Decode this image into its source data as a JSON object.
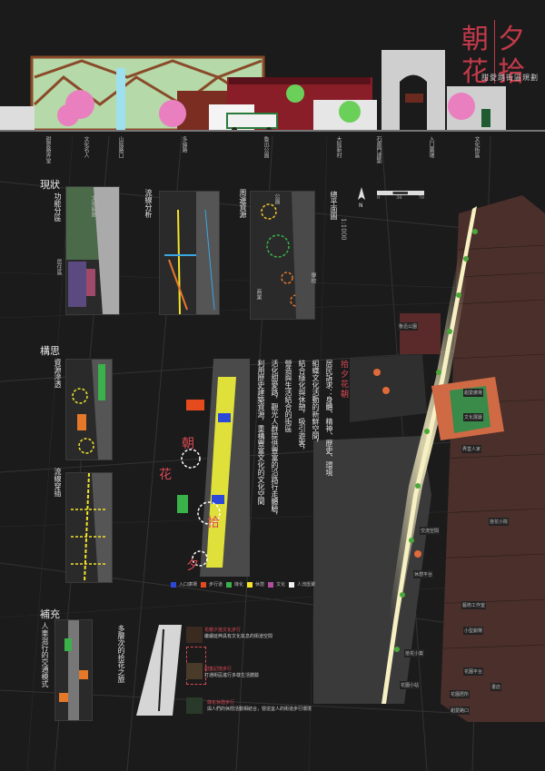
{
  "title": {
    "chars": [
      "朝",
      "夕",
      "花",
      "拾"
    ],
    "subtitle": "甜愛路街區規劃"
  },
  "elevation_labels": [
    "甜愛路弄堂",
    "文化名人",
    "山陰路口",
    "多倫路",
    "魯迅公園",
    "大陸新村",
    "石庫門建築",
    "入口廣場",
    "文化街區"
  ],
  "sections": {
    "current": {
      "heading": "現狀",
      "sub": "功能分區"
    },
    "flow": {
      "heading": "流線分析"
    },
    "surround": {
      "heading": "周邊資源"
    },
    "masterplan": {
      "heading": "總平面圖",
      "scale": "1:1000",
      "scale_ticks": [
        "0",
        "30",
        "70"
      ]
    },
    "concept": {
      "heading": "構思",
      "sub1": "資源滲透",
      "sub2": "流線穿插"
    },
    "supplement": {
      "heading": "補充",
      "sub": "人車混行的交通模式"
    },
    "multi": {
      "heading": "多層次的拾花之旅"
    }
  },
  "concept_text": {
    "heading": "拾夕花朝",
    "lines": [
      "居民訴求：身體、精神、歷史、環境",
      "組織文化活動的新鮮空間，",
      "結合綠化與休憩，吸引遊客，",
      "營造與生活結合的街區",
      "活化甜愛路，觀光人群提供豐富的沿路行走體驗，",
      "利用歷史建築資源，重構豐富文化的文化空間"
    ]
  },
  "legend": [
    "入口廣場",
    "步行道",
    "綠化",
    "休憩",
    "文化",
    "人流匯聚"
  ],
  "legend_colors": [
    "#2b48d8",
    "#e64b1e",
    "#3ab24a",
    "#f4e52a",
    "#b24ea0",
    "#f2f2f2"
  ],
  "map_tags": [
    "魯迅公園",
    "甜愛廣場",
    "文化展廳",
    "弄堂人家",
    "拾花小院",
    "交流空間",
    "休憩平台",
    "藝術工作室",
    "小型劇場",
    "拾花小築",
    "花園平台",
    "花園小站",
    "花園居所",
    "書店",
    "甜愛路口"
  ],
  "layer_notes": [
    {
      "title": "花朝夕拾文化步行",
      "text": "繼續延伸具有文化氣息的街道空間"
    },
    {
      "title": "甜蜜記憶步行",
      "text": "打通街區進行多樣生活體驗"
    },
    {
      "title": "綠化休憩步行",
      "text": "與人們的休閒活動相結合，營造宜人的街道步行環境"
    }
  ],
  "current_labels": [
    "居住區",
    "文化設施",
    "商業",
    "公園綠地"
  ],
  "surround_labels": [
    "公園",
    "學校",
    "商業"
  ]
}
